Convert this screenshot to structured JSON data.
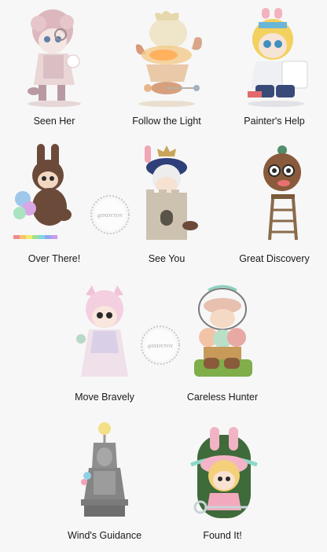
{
  "watermark": "@INDYTOY",
  "figures": [
    {
      "name": "Seen Her",
      "icon": "pink-haired-doll-figure-icon"
    },
    {
      "name": "Follow the Light",
      "icon": "flame-creature-figure-icon"
    },
    {
      "name": "Painter's Help",
      "icon": "blonde-painter-figure-icon"
    },
    {
      "name": "Over There!",
      "icon": "bunny-balloon-figure-icon"
    },
    {
      "name": "See You",
      "icon": "castle-tower-figure-icon"
    },
    {
      "name": "Great Discovery",
      "icon": "ladder-figure-icon"
    },
    {
      "name": "Move Bravely",
      "icon": "cat-eared-girl-figure-icon"
    },
    {
      "name": "Careless Hunter",
      "icon": "mushroom-hunter-figure-icon"
    },
    {
      "name": "Wind's Guidance",
      "icon": "stone-statue-figure-icon"
    },
    {
      "name": "Found It!",
      "icon": "bunny-hat-key-figure-icon"
    }
  ]
}
